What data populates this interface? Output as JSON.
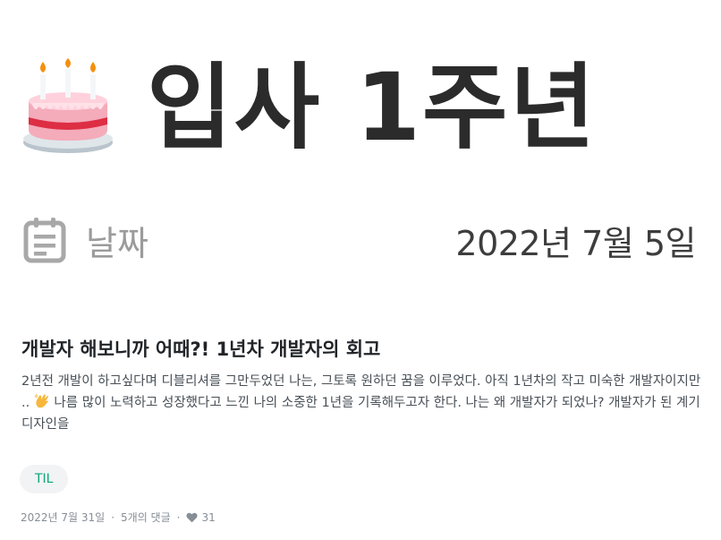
{
  "thumbnail": {
    "title": "입사 1주년",
    "property_label": "날짜",
    "property_value": "2022년 7월 5일",
    "icons": [
      "birthday-cake-icon",
      "calendar-icon"
    ]
  },
  "post": {
    "title": "개발자 해보니까 어때?! 1년차 개발자의 회고",
    "description_before_emoji": "2년전 개발이 하고싶다며 디블리셔를 그만두었던 나는, 그토록 원하던 꿈을 이루었다. 아직 1년차의 작고 미숙한 개발자이지만 .. ",
    "description_after_emoji": " 나름 많이 노력하고 성장했다고 느낀 나의 소중한 1년을 기록해두고자 한다. 나는 왜 개발자가 되었나? 개발자가 된 계기 디자인을",
    "emoji_icon": "waving-hand-icon",
    "tag": "TIL",
    "date": "2022년 7월 31일",
    "separator": "·",
    "comments": "5개의 댓글",
    "likes": "31"
  },
  "colors": {
    "tag_text": "#0ca678",
    "tag_bg": "#f1f3f5",
    "meta_text": "#868e96"
  }
}
